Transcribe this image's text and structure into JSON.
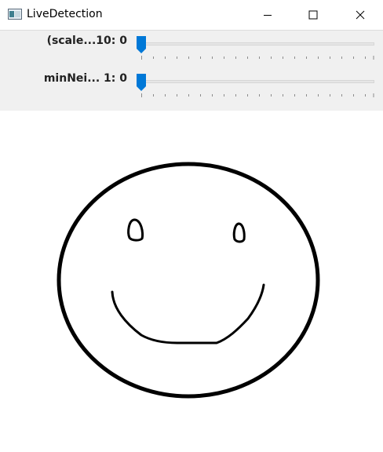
{
  "window": {
    "title": "LiveDetection",
    "minimize_icon": "minimize-icon",
    "maximize_icon": "maximize-icon",
    "close_icon": "close-icon"
  },
  "trackbars": [
    {
      "label": "(scale...10: 0",
      "value": 0,
      "fraction": 0.0
    },
    {
      "label": "minNei... 1: 0",
      "value": 0,
      "fraction": 0.0
    }
  ],
  "colors": {
    "thumb": "#0078d7",
    "panel": "#f0f0f0",
    "drawing": "#000000"
  },
  "canvas": {
    "content": "hand-drawn smiley face"
  }
}
